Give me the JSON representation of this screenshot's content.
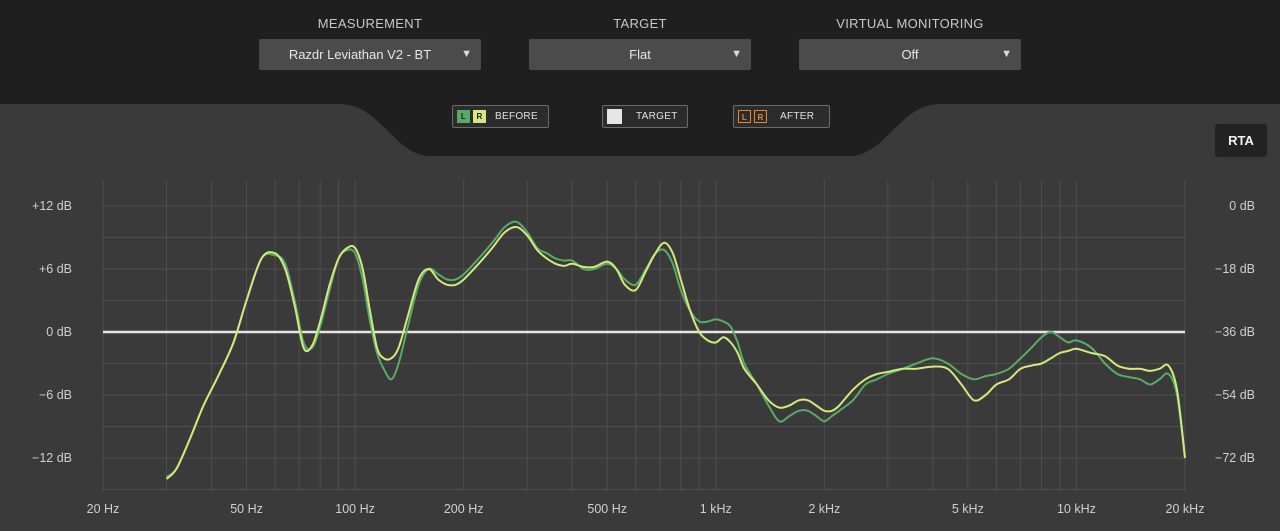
{
  "header": {
    "measurement": {
      "label": "MEASUREMENT",
      "value": "Razdr Leviathan V2 - BT"
    },
    "target": {
      "label": "TARGET",
      "value": "Flat"
    },
    "virtual_monitoring": {
      "label": "VIRTUAL MONITORING",
      "value": "Off"
    }
  },
  "legend": {
    "before": {
      "l": "L",
      "r": "R",
      "label": "BEFORE"
    },
    "target": {
      "label": "TARGET"
    },
    "after": {
      "l": "L",
      "r": "R",
      "label": "AFTER"
    }
  },
  "rta_button": "RTA",
  "colors": {
    "before_l": "#5aaa66",
    "before_r": "#d2ea7a",
    "target_line": "#e6e6e6",
    "after": "#e6892e",
    "plot_bg": "#3a3a3a"
  },
  "icons": {
    "dropdown": "triangle-down-icon"
  },
  "chart_data": {
    "type": "line",
    "x_scale": "log",
    "xlim": [
      20,
      20000
    ],
    "ylim": [
      -15,
      15
    ],
    "grid": true,
    "x_ticks": [
      {
        "v": 20,
        "label": "20 Hz"
      },
      {
        "v": 50,
        "label": "50 Hz"
      },
      {
        "v": 100,
        "label": "100 Hz"
      },
      {
        "v": 200,
        "label": "200 Hz"
      },
      {
        "v": 500,
        "label": "500 Hz"
      },
      {
        "v": 1000,
        "label": "1 kHz"
      },
      {
        "v": 2000,
        "label": "2 kHz"
      },
      {
        "v": 5000,
        "label": "5 kHz"
      },
      {
        "v": 10000,
        "label": "10 kHz"
      },
      {
        "v": 20000,
        "label": "20 kHz"
      }
    ],
    "y_ticks_left": [
      {
        "v": 12,
        "label": "+12 dB"
      },
      {
        "v": 6,
        "label": "+6 dB"
      },
      {
        "v": 0,
        "label": "0 dB"
      },
      {
        "v": -6,
        "label": "−6 dB"
      },
      {
        "v": -12,
        "label": "−12 dB"
      }
    ],
    "y_ticks_right": [
      {
        "v": 12,
        "label": "0 dB"
      },
      {
        "v": 6,
        "label": "−18 dB"
      },
      {
        "v": 0,
        "label": "−36 dB"
      },
      {
        "v": -6,
        "label": "−54 dB"
      },
      {
        "v": -12,
        "label": "−72 dB"
      }
    ],
    "target": {
      "x": [
        20,
        20000
      ],
      "y": [
        0,
        0
      ]
    },
    "series": [
      {
        "key": "before_l",
        "x": [
          30,
          32,
          35,
          38,
          42,
          46,
          50,
          55,
          60,
          64,
          68,
          72,
          76,
          80,
          85,
          90,
          95,
          100,
          105,
          110,
          115,
          120,
          126,
          132,
          140,
          150,
          160,
          170,
          180,
          190,
          200,
          220,
          240,
          260,
          280,
          300,
          320,
          340,
          360,
          380,
          400,
          430,
          460,
          500,
          530,
          560,
          600,
          640,
          680,
          720,
          760,
          800,
          850,
          900,
          950,
          1000,
          1050,
          1100,
          1150,
          1200,
          1300,
          1400,
          1500,
          1600,
          1700,
          1800,
          1900,
          2000,
          2100,
          2200,
          2400,
          2600,
          2800,
          3000,
          3300,
          3600,
          4000,
          4400,
          4800,
          5200,
          5600,
          6000,
          6500,
          7000,
          7500,
          8000,
          8500,
          9000,
          9500,
          10000,
          11000,
          12000,
          13000,
          14000,
          15000,
          16000,
          17000,
          18000,
          19000,
          20000
        ],
        "y": [
          -13.8,
          -13,
          -10,
          -7,
          -4,
          -1,
          3,
          7,
          7.3,
          6.5,
          3,
          -1,
          -1.5,
          0.5,
          4,
          7,
          7.8,
          7.5,
          5,
          1,
          -2,
          -3.5,
          -4.5,
          -3,
          0.5,
          4.5,
          6,
          5.5,
          5,
          5,
          5.5,
          7,
          8.5,
          10,
          10.5,
          9.5,
          8,
          7.5,
          7,
          6.8,
          6.8,
          6,
          6,
          6.5,
          6,
          5,
          4.5,
          6,
          7.5,
          7.8,
          6.5,
          4,
          2,
          1,
          1,
          1.2,
          1,
          0.5,
          -1,
          -3,
          -5,
          -7,
          -8.5,
          -8,
          -7.5,
          -7.5,
          -8,
          -8.5,
          -8,
          -7.5,
          -6.5,
          -5,
          -4.5,
          -4,
          -3.5,
          -3,
          -2.5,
          -3,
          -4,
          -4.5,
          -4.2,
          -4,
          -3.5,
          -2.5,
          -1.5,
          -0.5,
          0,
          -0.5,
          -1,
          -0.8,
          -1.5,
          -3,
          -4,
          -4.3,
          -4.5,
          -5,
          -4.5,
          -4,
          -6,
          -12
        ]
      },
      {
        "key": "before_r",
        "x": [
          30,
          32,
          35,
          38,
          42,
          46,
          50,
          55,
          60,
          64,
          68,
          72,
          76,
          80,
          85,
          90,
          95,
          100,
          105,
          110,
          115,
          120,
          126,
          132,
          140,
          150,
          160,
          170,
          180,
          190,
          200,
          220,
          240,
          260,
          280,
          300,
          320,
          340,
          360,
          380,
          400,
          430,
          460,
          500,
          530,
          560,
          600,
          640,
          680,
          720,
          760,
          800,
          850,
          900,
          950,
          1000,
          1050,
          1100,
          1150,
          1200,
          1300,
          1400,
          1500,
          1600,
          1700,
          1800,
          1900,
          2000,
          2100,
          2200,
          2400,
          2600,
          2800,
          3000,
          3300,
          3600,
          4000,
          4400,
          4800,
          5200,
          5600,
          6000,
          6500,
          7000,
          7500,
          8000,
          8500,
          9000,
          9500,
          10000,
          11000,
          12000,
          13000,
          14000,
          15000,
          16000,
          17000,
          18000,
          19000,
          20000
        ],
        "y": [
          -14,
          -13,
          -10,
          -7,
          -4,
          -1,
          3,
          7,
          7.5,
          6,
          2.5,
          -1.5,
          -1.3,
          1,
          4.5,
          7,
          8,
          8,
          6,
          2,
          -1.5,
          -2.5,
          -2.5,
          -1.5,
          1.5,
          5,
          6,
          5,
          4.5,
          4.5,
          5,
          6.5,
          8,
          9.5,
          10,
          9.2,
          7.8,
          7,
          6.5,
          6.3,
          6.5,
          6.2,
          6.2,
          6.7,
          6,
          4.5,
          4,
          5.8,
          7.5,
          8.5,
          7.5,
          5,
          2,
          0,
          -0.8,
          -1,
          -0.5,
          -1,
          -2,
          -3.5,
          -5,
          -6.5,
          -7.2,
          -7,
          -6.5,
          -6.5,
          -7,
          -7.5,
          -7.5,
          -7,
          -5.5,
          -4.5,
          -4,
          -3.8,
          -3.5,
          -3.5,
          -3.3,
          -3.5,
          -5,
          -6.5,
          -6,
          -5,
          -4.5,
          -3.5,
          -3.2,
          -3,
          -2.5,
          -2,
          -1.8,
          -1.6,
          -2,
          -2.3,
          -3.2,
          -3.5,
          -3.5,
          -3.7,
          -3.5,
          -3.2,
          -5.5,
          -12
        ]
      }
    ]
  }
}
